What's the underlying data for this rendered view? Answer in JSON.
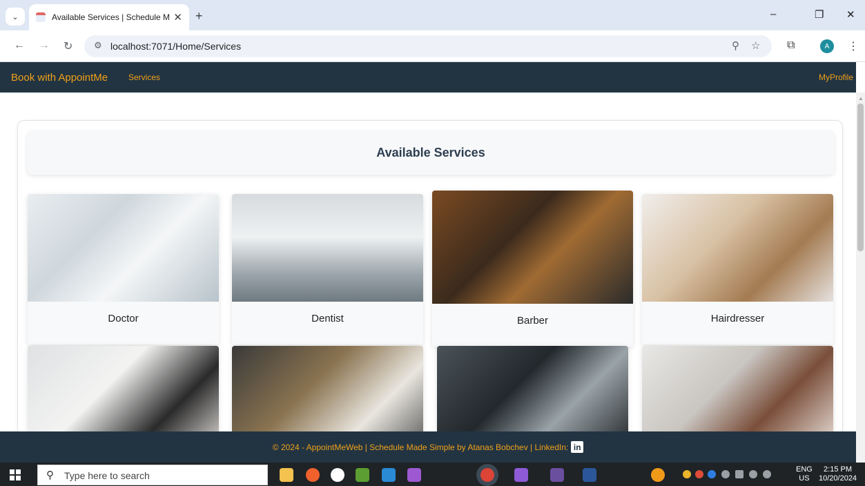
{
  "browser": {
    "tab_title": "Available Services | Schedule M",
    "tab_close": "✕",
    "new_tab": "+",
    "url": "localhost:7071/Home/Services",
    "profile_initial": "A",
    "window_minimize": "–",
    "window_restore": "❐",
    "window_close": "✕"
  },
  "navbar": {
    "brand": "Book with AppointMe",
    "services_link": "Services",
    "profile_link": "MyProfile"
  },
  "main": {
    "title": "Available Services",
    "services": [
      {
        "name": "Doctor"
      },
      {
        "name": "Dentist"
      },
      {
        "name": "Barber"
      },
      {
        "name": "Hairdresser"
      },
      {
        "name": ""
      },
      {
        "name": ""
      },
      {
        "name": ""
      },
      {
        "name": ""
      }
    ]
  },
  "footer": {
    "text": "© 2024 - AppointMeWeb | Schedule Made Simple by Atanas Bobchev | LinkedIn:",
    "linkedin_icon": "in"
  },
  "taskbar": {
    "search_placeholder": "Type here to search",
    "language": "ENG",
    "region": "US",
    "time": "2:15 PM",
    "date": "10/20/2024"
  },
  "colors": {
    "navbar_bg": "#223442",
    "accent": "#f0a019",
    "title_text": "#2d3e50"
  }
}
